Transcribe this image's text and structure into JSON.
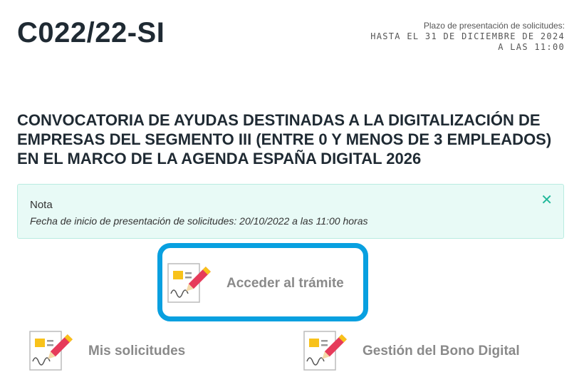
{
  "procedure": {
    "code": "C022/22-SI",
    "deadline_label": "Plazo de presentación de solicitudes:",
    "deadline_date": "HASTA EL 31 DE DICIEMBRE DE 2024",
    "deadline_time": "A LAS 11:00",
    "title": "CONVOCATORIA DE AYUDAS DESTINADAS A LA DIGITALIZACIÓN DE EMPRESAS DEL SEGMENTO III (ENTRE 0 Y MENOS DE 3 EMPLEADOS) EN EL MARCO DE LA AGENDA ESPAÑA DIGITAL 2026"
  },
  "note": {
    "title": "Nota",
    "text": "Fecha de inicio de presentación de solicitudes: 20/10/2022 a las 11:00 horas",
    "close_icon": "close-icon",
    "close_symbol": "✕"
  },
  "actions": {
    "access": {
      "label": "Acceder al trámite",
      "icon": "document-pen-icon"
    },
    "my_requests": {
      "label": "Mis solicitudes",
      "icon": "document-pen-icon"
    },
    "bono": {
      "label": "Gestión del Bono Digital",
      "icon": "document-pen-icon"
    }
  },
  "colors": {
    "highlight": "#08a0e0",
    "note_bg": "#e8faf6",
    "note_close": "#21b89a"
  }
}
